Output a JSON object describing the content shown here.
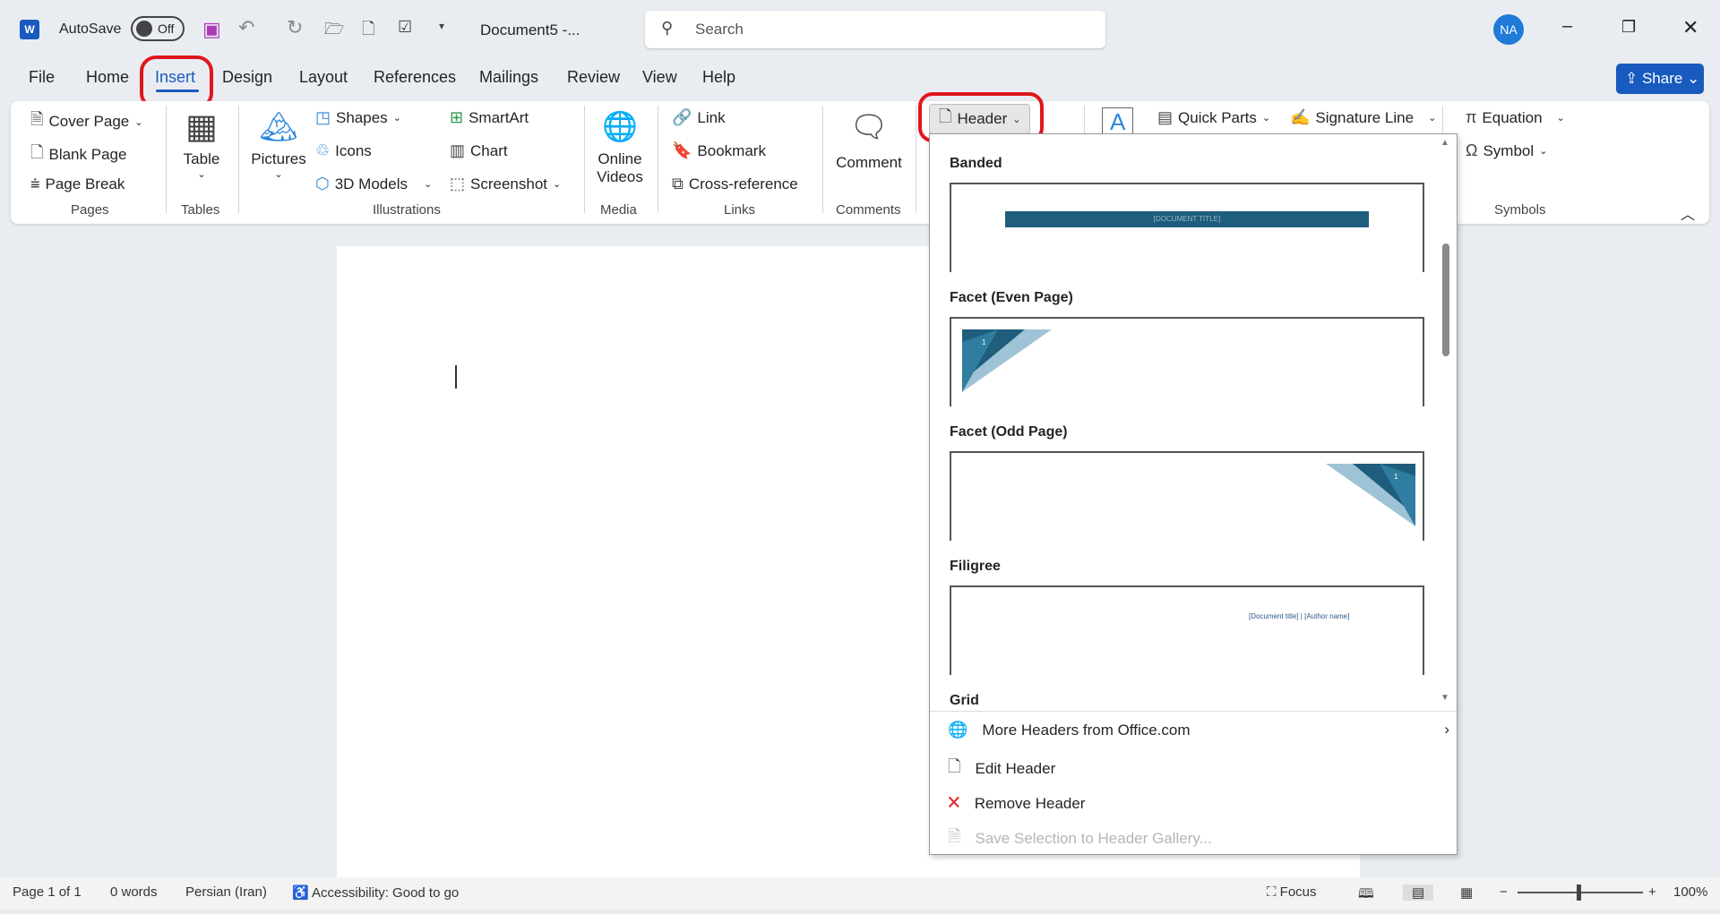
{
  "titlebar": {
    "app_icon": "word-icon",
    "autosave_label": "AutoSave",
    "autosave_state": "Off",
    "doc_title": "Document5 -...",
    "search_placeholder": "Search",
    "avatar": "NA"
  },
  "tabs": [
    {
      "label": "File"
    },
    {
      "label": "Home"
    },
    {
      "label": "Insert",
      "active": true
    },
    {
      "label": "Design"
    },
    {
      "label": "Layout"
    },
    {
      "label": "References"
    },
    {
      "label": "Mailings"
    },
    {
      "label": "Review"
    },
    {
      "label": "View"
    },
    {
      "label": "Help"
    }
  ],
  "share_label": "Share",
  "ribbon": {
    "pages": {
      "label": "Pages",
      "items": [
        "Cover Page",
        "Blank Page",
        "Page Break"
      ]
    },
    "tables": {
      "label": "Tables",
      "table": "Table"
    },
    "illustrations": {
      "label": "Illustrations",
      "pictures": "Pictures",
      "items": [
        "Shapes",
        "Icons",
        "3D Models",
        "SmartArt",
        "Chart",
        "Screenshot"
      ]
    },
    "media": {
      "label": "Media",
      "online_videos": [
        "Online",
        "Videos"
      ]
    },
    "links": {
      "label": "Links",
      "items": [
        "Link",
        "Bookmark",
        "Cross-reference"
      ]
    },
    "comments": {
      "label": "Comments",
      "comment": "Comment"
    },
    "header_button": "Header",
    "text": {
      "quick_parts": "Quick Parts",
      "signature_line": "Signature Line"
    },
    "symbols": {
      "label": "Symbols",
      "equation": "Equation",
      "symbol": "Symbol"
    }
  },
  "header_menu": {
    "gallery": [
      {
        "name": "Banded",
        "sample": "[DOCUMENT TITLE]"
      },
      {
        "name": "Facet (Even Page)",
        "sample": "1"
      },
      {
        "name": "Facet (Odd Page)",
        "sample": "1"
      },
      {
        "name": "Filigree",
        "sample": "[Document title] | [Author name]"
      },
      {
        "name": "Grid"
      }
    ],
    "items": [
      {
        "label": "More Headers from Office.com",
        "enabled": true
      },
      {
        "label": "Edit Header",
        "enabled": true
      },
      {
        "label": "Remove Header",
        "enabled": true
      },
      {
        "label": "Save Selection to Header Gallery...",
        "enabled": false
      }
    ]
  },
  "status": {
    "page": "Page 1 of 1",
    "words": "0 words",
    "language": "Persian (Iran)",
    "accessibility": "Accessibility: Good to go",
    "focus": "Focus",
    "zoom": "100%",
    "zoom_percent": 100
  },
  "colors": {
    "accent": "#185abd",
    "highlight": "#e0161b",
    "banded": "#1e5d7c"
  }
}
